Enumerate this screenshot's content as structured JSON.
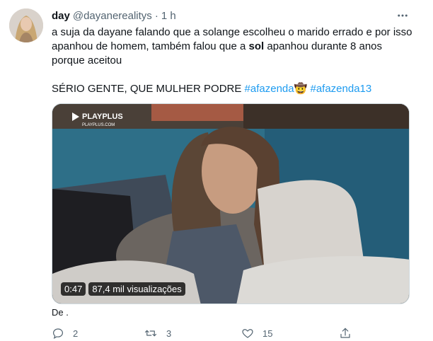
{
  "author": {
    "name": "day",
    "handle": "@dayanerealitys",
    "separator": "·",
    "time": "1 h"
  },
  "tweet": {
    "line1": "a suja da dayane falando que a solange escolheu o marido errado e por isso",
    "line2_pre": "apanhou de homem, também falou que a ",
    "line2_bold": "sol",
    "line2_post": " apanhou durante 8 anos",
    "line3": "porque aceitou",
    "line4_text": "SÉRIO GENTE, QUE MULHER PODRE ",
    "hashtag1": "#afazenda",
    "hashtag1_emoji": "🤠",
    "hashtag2": "#afazenda13"
  },
  "video": {
    "brand": "PLAYPLUS",
    "brand_url": "PLAYPLUS.COM",
    "duration": "0:47",
    "views": "87,4 mil visualizações"
  },
  "origin": "De .",
  "actions": {
    "replies": "2",
    "retweets": "3",
    "likes": "15"
  },
  "icons": [
    "more-icon",
    "reply-icon",
    "retweet-icon",
    "like-icon",
    "share-icon"
  ],
  "colors": {
    "hashtag": "#1d9bf0",
    "secondary": "#536471"
  }
}
